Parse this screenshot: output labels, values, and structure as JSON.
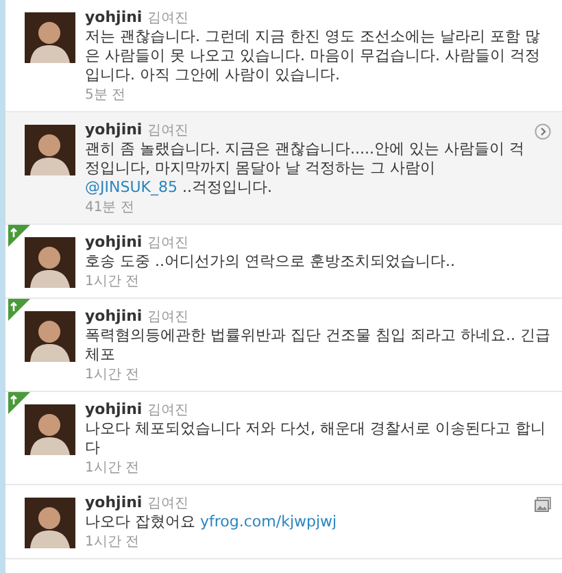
{
  "tweets": [
    {
      "username": "yohjini",
      "display_name": "김여진",
      "parts": [
        {
          "kind": "plain",
          "text": "저는 괜찮습니다. 그런데 지금 한진 영도 조선소에는 날라리 포함 많은 사람들이 못 나오고 있습니다. 마음이 무겁습니다. 사람들이 걱정입니다. 아직 그안에 사람이 있습니다."
        }
      ],
      "time": "5분 전",
      "highlighted": false,
      "flagged": false
    },
    {
      "username": "yohjini",
      "display_name": "김여진",
      "parts": [
        {
          "kind": "plain",
          "text": "괜히 좀 놀랬습니다. 지금은 괜찮습니다.....안에 있는 사람들이 걱정입니다, 마지막까지 몸달아 날 걱정하는 그 사람이 "
        },
        {
          "kind": "link",
          "text": "@JINSUK_85"
        },
        {
          "kind": "plain",
          "text": " ..걱정입니다."
        }
      ],
      "time": "41분 전",
      "highlighted": true,
      "flagged": false,
      "side_icon": {
        "kind": "arrow"
      }
    },
    {
      "username": "yohjini",
      "display_name": "김여진",
      "parts": [
        {
          "kind": "plain",
          "text": "호송 도중 ..어디선가의 연락으로 훈방조치되었습니다.."
        }
      ],
      "time": "1시간 전",
      "highlighted": false,
      "flagged": true
    },
    {
      "username": "yohjini",
      "display_name": "김여진",
      "parts": [
        {
          "kind": "plain",
          "text": "폭력혐의등에관한 법률위반과 집단 건조물 침입 죄라고 하네요.. 긴급체포"
        }
      ],
      "time": "1시간 전",
      "highlighted": false,
      "flagged": true
    },
    {
      "username": "yohjini",
      "display_name": "김여진",
      "parts": [
        {
          "kind": "plain",
          "text": "나오다 체포되었습니다 저와 다섯, 해운대 경찰서로 이송된다고 합니다"
        }
      ],
      "time": "1시간 전",
      "highlighted": false,
      "flagged": true
    },
    {
      "username": "yohjini",
      "display_name": "김여진",
      "parts": [
        {
          "kind": "plain",
          "text": "나오다 잡혔어요 "
        },
        {
          "kind": "link",
          "text": "yfrog.com/kjwpjwj"
        }
      ],
      "time": "1시간 전",
      "highlighted": false,
      "flagged": false,
      "side_icon": {
        "kind": "photo"
      }
    }
  ]
}
